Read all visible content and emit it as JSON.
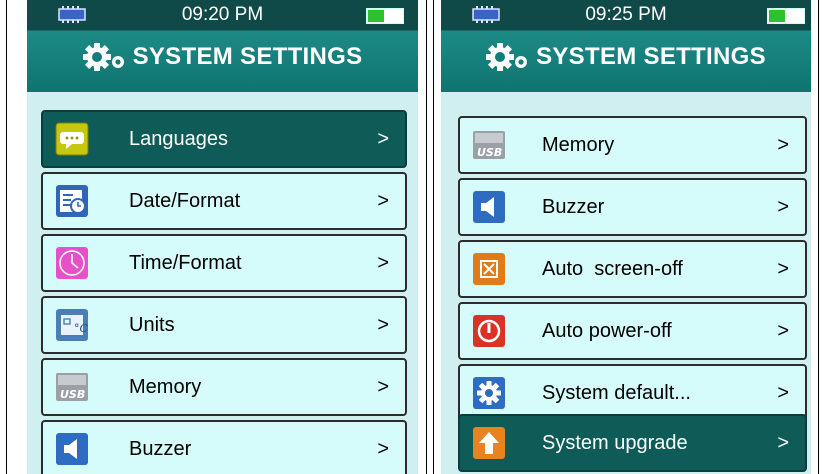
{
  "left_screen": {
    "status_time": "09:20 PM",
    "title": "SYSTEM SETTINGS",
    "battery_level": 0.45,
    "items": [
      {
        "label": "Languages",
        "arrow": ">",
        "icon": "speech-bubble-icon",
        "selected": true
      },
      {
        "label": "Date/Format",
        "arrow": ">",
        "icon": "calendar-clock-icon",
        "selected": false
      },
      {
        "label": "Time/Format",
        "arrow": ">",
        "icon": "clock-icon",
        "selected": false
      },
      {
        "label": "Units",
        "arrow": ">",
        "icon": "units-icon",
        "selected": false
      },
      {
        "label": "Memory",
        "arrow": ">",
        "icon": "usb-memory-icon",
        "selected": false
      },
      {
        "label": "Buzzer",
        "arrow": ">",
        "icon": "speaker-icon",
        "selected": false
      }
    ]
  },
  "right_screen": {
    "status_time": "09:25 PM",
    "title": "SYSTEM SETTINGS",
    "battery_level": 0.45,
    "items": [
      {
        "label": "Memory",
        "arrow": ">",
        "icon": "usb-memory-icon",
        "selected": false
      },
      {
        "label": "Buzzer",
        "arrow": ">",
        "icon": "speaker-icon",
        "selected": false
      },
      {
        "label": "Auto  screen-off",
        "arrow": ">",
        "icon": "screen-off-icon",
        "selected": false
      },
      {
        "label": "Auto power-off",
        "arrow": ">",
        "icon": "power-icon",
        "selected": false
      },
      {
        "label": "System default...",
        "arrow": ">",
        "icon": "gear-icon",
        "selected": false
      },
      {
        "label": "System upgrade",
        "arrow": ">",
        "icon": "upgrade-arrow-icon",
        "selected": true
      }
    ]
  },
  "colors": {
    "header": "#0f7470",
    "list_background": "#cfeff0",
    "item_background": "#d6fbfb",
    "selected_item": "#0f5b58",
    "battery_fill": "#2ec12e"
  }
}
